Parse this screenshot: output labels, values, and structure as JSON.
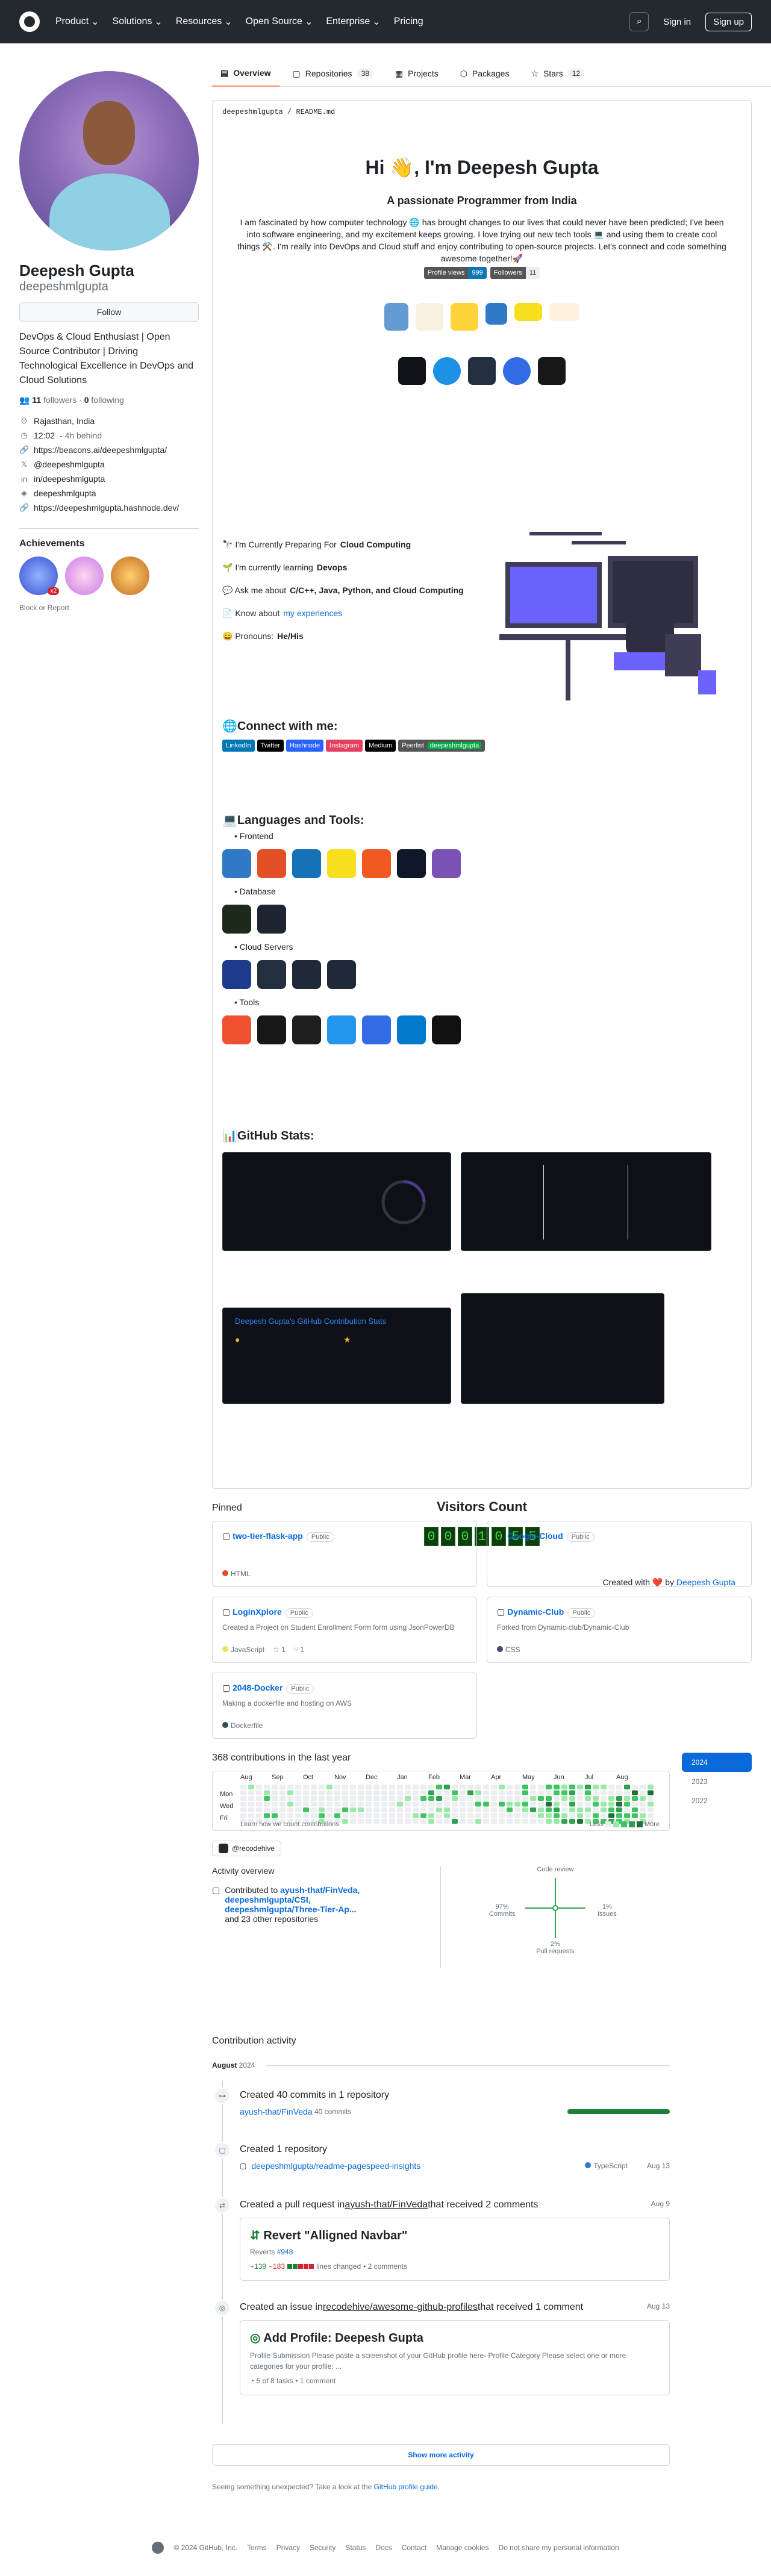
{
  "header": {
    "nav": [
      "Product",
      "Solutions",
      "Resources",
      "Open Source",
      "Enterprise",
      "Pricing"
    ],
    "signin": "Sign in",
    "signup": "Sign up"
  },
  "tabs": [
    {
      "label": "Overview"
    },
    {
      "label": "Repositories",
      "count": "38"
    },
    {
      "label": "Projects"
    },
    {
      "label": "Packages"
    },
    {
      "label": "Stars",
      "count": "12"
    }
  ],
  "profile": {
    "name": "Deepesh Gupta",
    "login": "deepeshmlgupta",
    "follow": "Follow",
    "bio": "DevOps & Cloud Enthusiast | Open Source Contributor | Driving Technological Excellence in DevOps and Cloud Solutions",
    "followers": "11",
    "followers_label": "followers",
    "following": "0",
    "following_label": "following",
    "location": "Rajasthan, India",
    "time": "12:02",
    "time_behind": "- 4h behind",
    "links": [
      "https://beacons.ai/deepeshmlgupta/",
      "@deepeshmlgupta",
      "in/deepeshmlgupta",
      "deepeshmlgupta",
      "https://deepeshmlgupta.hashnode.dev/"
    ],
    "achievements": "Achievements",
    "badge_count": "x2",
    "block": "Block or Report"
  },
  "readme": {
    "path": "deepeshmlgupta",
    "file": "README.md",
    "hi": "Hi 👋, I'm Deepesh Gupta",
    "sub": "A passionate Programmer from India",
    "intro": "I am fascinated by how computer technology 🌐 has brought changes to our lives that could never have been predicted; I've been into software engineering, and my excitement keeps growing. I love trying out new tech tools 💻 and using them to create cool things ⚒️. I'm really into DevOps and Cloud stuff and enjoy contributing to open-source projects. Let's connect and code something awesome together!🚀",
    "shield_views_l": "Profile views",
    "shield_views_r": "999",
    "shield_follow_l": "Followers",
    "shield_follow_r": "11",
    "bullets": [
      "🔭 I'm Currently Preparing For ",
      "🌱 I'm currently learning ",
      "💬 Ask me about ",
      "📄 Know about ",
      "😄 Pronouns: "
    ],
    "bullets_bold": [
      "Cloud Computing",
      "Devops",
      "C/C++, Java, Python, and Cloud Computing",
      "my experiences",
      "He/His"
    ],
    "connect": "🌐Connect with me:",
    "connect_badges": [
      "LinkedIn",
      "Twitter",
      "Hashnode",
      "Instagram",
      "Medium",
      "Peerlist",
      "deepeshmlgupta"
    ],
    "tools_title": "💻Languages and Tools:",
    "cats": [
      "Frontend",
      "Database",
      "Cloud Servers",
      "Tools"
    ],
    "stats_title": "📊GitHub Stats:",
    "trophy_text": "Deepesh Gupta's GitHub Contribution Stats",
    "visitors": "Visitors Count",
    "digits": [
      "0",
      "0",
      "0",
      "1",
      "0",
      "5",
      "5"
    ],
    "made_with": "Created with ❤️ by ",
    "made_by": "Deepesh Gupta"
  },
  "pinned": {
    "title": "Pinned",
    "public": "Public",
    "items": [
      {
        "name": "two-tier-flask-app",
        "desc": "",
        "lang": "HTML",
        "color": "#e34c26",
        "stars": "",
        "forks": ""
      },
      {
        "name": "Google-Cloud",
        "desc": "",
        "lang": "",
        "color": "",
        "stars": "",
        "forks": ""
      },
      {
        "name": "LoginXplore",
        "desc": "Created a Project on Student Enrollment Form form using JsonPowerDB",
        "lang": "JavaScript",
        "color": "#f1e05a",
        "stars": "1",
        "forks": "1"
      },
      {
        "name": "Dynamic-Club",
        "desc": "Forked from Dynamic-club/Dynamic-Club",
        "lang": "CSS",
        "color": "#563d7c",
        "stars": "",
        "forks": ""
      },
      {
        "name": "2048-Docker",
        "desc": "Making a dockerfile and hosting on AWS",
        "lang": "Dockerfile",
        "color": "#384d54",
        "stars": "",
        "forks": ""
      }
    ]
  },
  "contrib": {
    "title": "368 contributions in the last year",
    "months": [
      "Aug",
      "Sep",
      "Oct",
      "Nov",
      "Dec",
      "Jan",
      "Feb",
      "Mar",
      "Apr",
      "May",
      "Jun",
      "Jul",
      "Aug"
    ],
    "days": [
      "Mon",
      "Wed",
      "Fri"
    ],
    "learn": "Learn how we count contributions",
    "less": "Less",
    "more": "More",
    "years": [
      "2024",
      "2023",
      "2022"
    ],
    "org": "@recodehive",
    "overview": "Activity overview",
    "contributed": "Contributed to ",
    "repos": [
      "ayush-that/FinVeda,",
      "deepeshmlgupta/CSI,",
      "deepeshmlgupta/Three-Tier-Ap..."
    ],
    "others": "and 23 other repositories",
    "axes": {
      "top": "Code review",
      "left_pct": "97%",
      "left": "Commits",
      "right_pct": "1%",
      "right": "Issues",
      "bottom_pct": "2%",
      "bottom": "Pull requests"
    }
  },
  "activity": {
    "title": "Contribution activity",
    "month": "August",
    "year": "2024",
    "commits": "Created 40 commits in 1 repository",
    "commit_repo": "ayush-that/FinVeda",
    "commit_count": "40 commits",
    "created": "Created 1 repository",
    "created_repo": "deepeshmlgupta/readme-pagespeed-insights",
    "created_lang": "TypeScript",
    "created_date": "Aug 13",
    "pr": "Created a pull request in ",
    "pr_repo": "ayush-that/FinVeda",
    "pr_rest": " that received 2 comments",
    "pr_date": "Aug 9",
    "pr_title": "Revert \"Alligned Navbar\"",
    "pr_reverts": "Reverts ",
    "pr_num": "#948",
    "pr_add": "+139",
    "pr_del": "−183",
    "pr_lines": "lines changed",
    "pr_comments": "• 2 comments",
    "issue": "Created an issue in ",
    "issue_repo": "recodehive/awesome-github-profiles",
    "issue_rest": " that received 1 comment",
    "issue_date": "Aug 13",
    "issue_title": "Add Profile: Deepesh Gupta",
    "issue_body": "Profile Submission Please paste a screenshot of your GitHub profile here- Profile Category Please select one or more categories for your profile: ...",
    "issue_tasks": "5 of 8 tasks",
    "issue_comments": "• 1 comment",
    "showmore": "Show more activity",
    "unexpected": "Seeing something unexpected? Take a look at the ",
    "guide": "GitHub profile guide",
    "period": "."
  },
  "footer": [
    "© 2024 GitHub, Inc.",
    "Terms",
    "Privacy",
    "Security",
    "Status",
    "Docs",
    "Contact",
    "Manage cookies",
    "Do not share my personal information"
  ]
}
